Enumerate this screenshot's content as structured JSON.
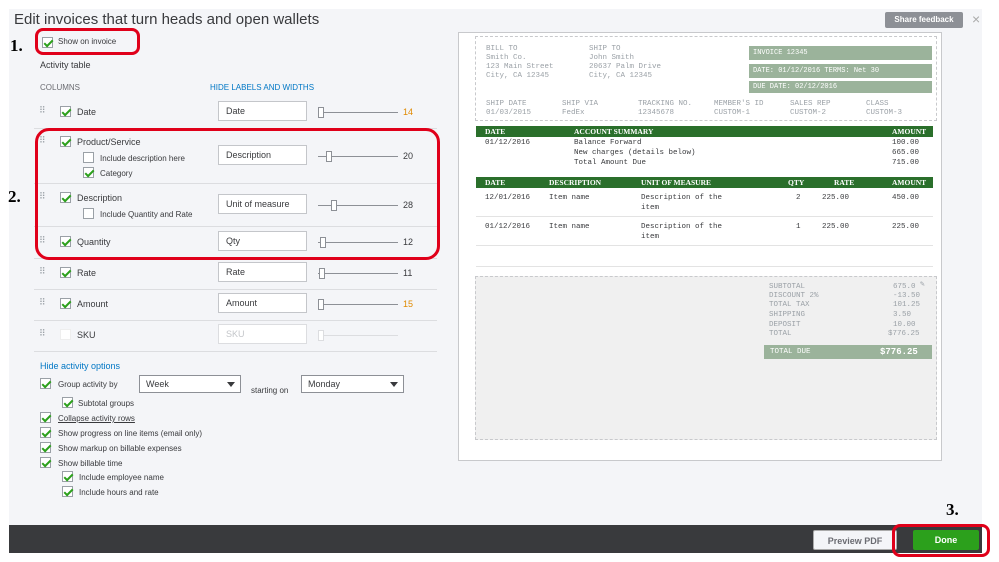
{
  "header": {
    "title": "Edit invoices that turn heads and open wallets",
    "share_feedback": "Share feedback",
    "close": "×"
  },
  "steps": {
    "one": "1.",
    "two": "2.",
    "three": "3."
  },
  "show_on_invoice": "Show on invoice",
  "activity_table": "Activity table",
  "columns_label": "COLUMNS",
  "hide_labels_link": "HIDE LABELS AND WIDTHS",
  "rows": [
    {
      "name": "Date",
      "field": "Date",
      "value": "14",
      "value_color": "#e08a00",
      "checked": true
    },
    {
      "name": "Product/Service",
      "field": "Description",
      "value": "20",
      "value_color": "#393a3d",
      "checked": true
    },
    {
      "name": "Description",
      "field": "Unit of measure",
      "value": "28",
      "value_color": "#393a3d",
      "checked": true
    },
    {
      "name": "Quantity",
      "field": "Qty",
      "value": "12",
      "value_color": "#393a3d",
      "checked": true
    },
    {
      "name": "Rate",
      "field": "Rate",
      "value": "11",
      "value_color": "#393a3d",
      "checked": true
    },
    {
      "name": "Amount",
      "field": "Amount",
      "value": "15",
      "value_color": "#e08a00",
      "checked": true
    },
    {
      "name": "SKU",
      "field": "SKU",
      "value": "",
      "checked": false
    }
  ],
  "product_sub": {
    "include_description": "Include description here",
    "category": "Category"
  },
  "description_sub": {
    "include_qty_rate": "Include Quantity and Rate"
  },
  "hide_activity_options": "Hide activity options",
  "group_activity_by": "Group activity by",
  "group_select": "Week",
  "starting_on": "starting on",
  "starting_select": "Monday",
  "options": {
    "subtotal_groups": "Subtotal groups",
    "collapse_rows": "Collapse activity rows",
    "show_progress": "Show progress on line items (email only)",
    "show_markup": "Show markup on billable expenses",
    "show_billable_time": "Show billable time",
    "include_employee": "Include employee name",
    "include_hours": "Include hours and rate"
  },
  "footer": {
    "preview_pdf": "Preview PDF",
    "done": "Done"
  },
  "invoice": {
    "bill_to_label": "BILL TO",
    "bill_to": [
      "Smith Co.",
      "123 Main Street",
      "City, CA 12345"
    ],
    "ship_to_label": "SHIP TO",
    "ship_to": [
      "John Smith",
      "20637 Palm Drive",
      "City, CA 12345"
    ],
    "invoice_no": "INVOICE 12345",
    "date_terms": "DATE: 01/12/2016   TERMS: Net 30",
    "due_date": "DUE DATE: 02/12/2016",
    "ship_headers": [
      "SHIP DATE",
      "SHIP VIA",
      "TRACKING NO.",
      "MEMBER'S ID",
      "SALES REP",
      "CLASS"
    ],
    "ship_values": [
      "01/03/2015",
      "FedEx",
      "12345678",
      "CUSTOM-1",
      "CUSTOM-2",
      "CUSTOM-3"
    ],
    "summary_headers": [
      "DATE",
      "ACCOUNT SUMMARY",
      "AMOUNT"
    ],
    "summary_date": "01/12/2016",
    "summary_rows": [
      {
        "label": "Balance Forward",
        "amount": "100.00"
      },
      {
        "label": "New charges (details below)",
        "amount": "665.00"
      },
      {
        "label": "Total Amount Due",
        "amount": "715.00"
      }
    ],
    "detail_headers": [
      "DATE",
      "DESCRIPTION",
      "UNIT OF MEASURE",
      "QTY",
      "RATE",
      "AMOUNT"
    ],
    "detail_rows": [
      {
        "date": "12/01/2016",
        "desc": "Item name",
        "uom1": "Description of the",
        "uom2": "item",
        "qty": "2",
        "rate": "225.00",
        "amount": "450.00"
      },
      {
        "date": "01/12/2016",
        "desc": "Item name",
        "uom1": "Description of the",
        "uom2": "item",
        "qty": "1",
        "rate": "225.00",
        "amount": "225.00"
      }
    ],
    "totals": [
      {
        "label": "SUBTOTAL",
        "value": "675.0"
      },
      {
        "label": "DISCOUNT 2%",
        "value": "-13.50"
      },
      {
        "label": "TOTAL TAX",
        "value": "101.25"
      },
      {
        "label": "SHIPPING",
        "value": "3.50"
      },
      {
        "label": "DEPOSIT",
        "value": "10.00"
      },
      {
        "label": "TOTAL",
        "value": "$776.25"
      }
    ],
    "total_due_label": "TOTAL DUE",
    "total_due_value": "$776.25"
  }
}
